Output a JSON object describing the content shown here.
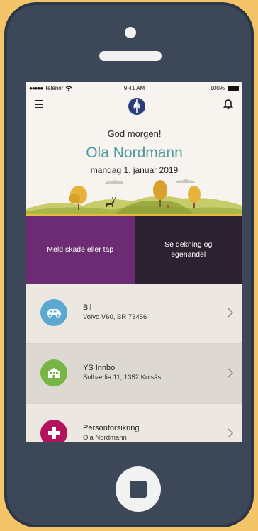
{
  "status_bar": {
    "carrier": "Telenor",
    "time": "9:41 AM",
    "battery": "100%"
  },
  "greeting": "God morgen!",
  "user_name": "Ola Nordmann",
  "date": "mandag 1. januar 2019",
  "actions": [
    {
      "label": "Meld skade eller tap"
    },
    {
      "label": "Se dekning og egenandel"
    }
  ],
  "insurances": [
    {
      "title": "Bil",
      "subtitle": "Volvo V60, BR 73456",
      "icon": "car-icon",
      "color": "#5ba8d0"
    },
    {
      "title": "YS Innbo",
      "subtitle": "Solbærlia 11, 1352 Kolsås",
      "icon": "house-icon",
      "color": "#77b547"
    },
    {
      "title": "Personforsikring",
      "subtitle": "Ola Nordmann",
      "icon": "medical-cross-icon",
      "color": "#b3135a"
    }
  ],
  "colors": {
    "background": "#f3c468",
    "phone_body": "#3c4858",
    "accent_teal": "#4a9aa0",
    "action_purple": "#6c2c74",
    "action_dark": "#2c2131"
  }
}
